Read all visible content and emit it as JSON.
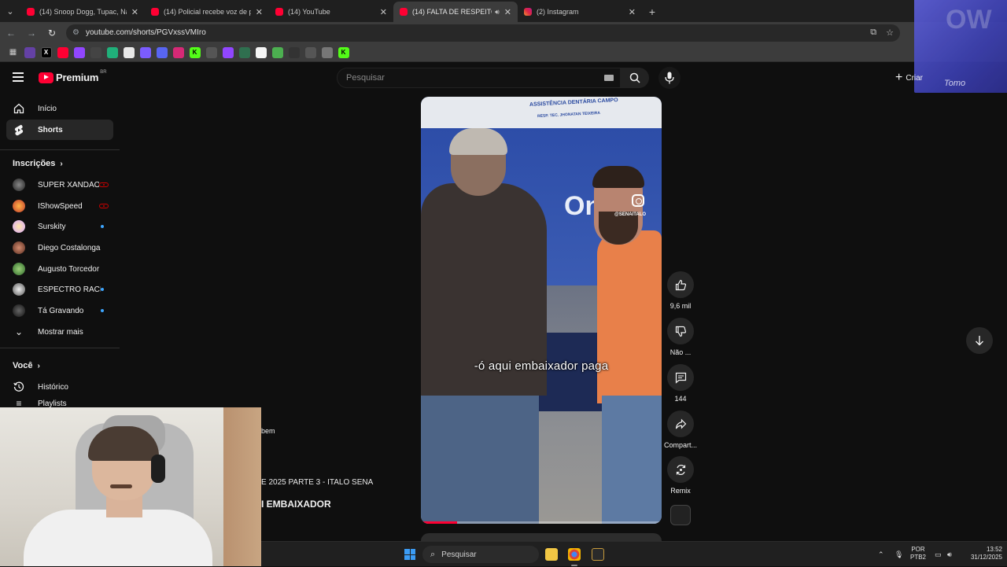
{
  "browser": {
    "tabs": [
      {
        "title": "(14) Snoop Dogg, Tupac, Nate",
        "favicon": "youtube-icon",
        "active": false
      },
      {
        "title": "(14) Policial recebe voz de prisão",
        "favicon": "youtube-icon",
        "active": false
      },
      {
        "title": "(14) YouTube",
        "favicon": "youtube-icon",
        "active": false
      },
      {
        "title": "(14) FALTA DE RESPEITO CO",
        "favicon": "youtube-icon",
        "active": true
      },
      {
        "title": "(2) Instagram",
        "favicon": "instagram-icon",
        "active": false
      }
    ],
    "url": "youtube.com/shorts/PGVxssVMIro"
  },
  "overlay": {
    "brand": "Tomo",
    "create_label": "Criar"
  },
  "youtube": {
    "logo_text": "Premium",
    "country_code": "BR",
    "search_placeholder": "Pesquisar"
  },
  "sidebar": {
    "nav": [
      {
        "label": "Início",
        "icon": "home-icon"
      },
      {
        "label": "Shorts",
        "icon": "shorts-icon",
        "active": true
      }
    ],
    "subscriptions_title": "Inscrições",
    "subscriptions": [
      {
        "label": "SUPER XANDÃO",
        "status": "live"
      },
      {
        "label": "IShowSpeed",
        "status": "live"
      },
      {
        "label": "Surskity",
        "status": "new"
      },
      {
        "label": "Diego Costalonga",
        "status": "none"
      },
      {
        "label": "Augusto Torcedor",
        "status": "none"
      },
      {
        "label": "ESPECTRO RACI...",
        "status": "new"
      },
      {
        "label": "Tá Gravando",
        "status": "new"
      }
    ],
    "show_more": "Mostrar mais",
    "you_title": "Você",
    "you_items": [
      {
        "label": "Histórico",
        "icon": "history-icon"
      },
      {
        "label": "Playlists",
        "icon": "playlist-icon"
      }
    ]
  },
  "short": {
    "banner_text": "ASSISTÊNCIA DENTÁRIA CAMPO",
    "banner_sub": "RESP. TEC. JHONATAN TEIXEIRA",
    "wall_text": "On",
    "watermark_handle": "@SENAITALO",
    "caption": "-ó aqui embaixador paga",
    "progress": 0.15,
    "partial_desc": "bem",
    "partial_title_1": "E 2025 PARTE 3 - ITALO SENA",
    "partial_title_2": "I EMBAIXADOR"
  },
  "actions": {
    "like_count": "9,6 mil",
    "dislike_label": "Não ...",
    "comments_count": "144",
    "share_label": "Compart...",
    "remix_label": "Remix"
  },
  "taskbar": {
    "search_placeholder": "Pesquisar",
    "lang_line1": "POR",
    "lang_line2": "PTB2",
    "time": "13:52",
    "date": "31/12/2025"
  }
}
